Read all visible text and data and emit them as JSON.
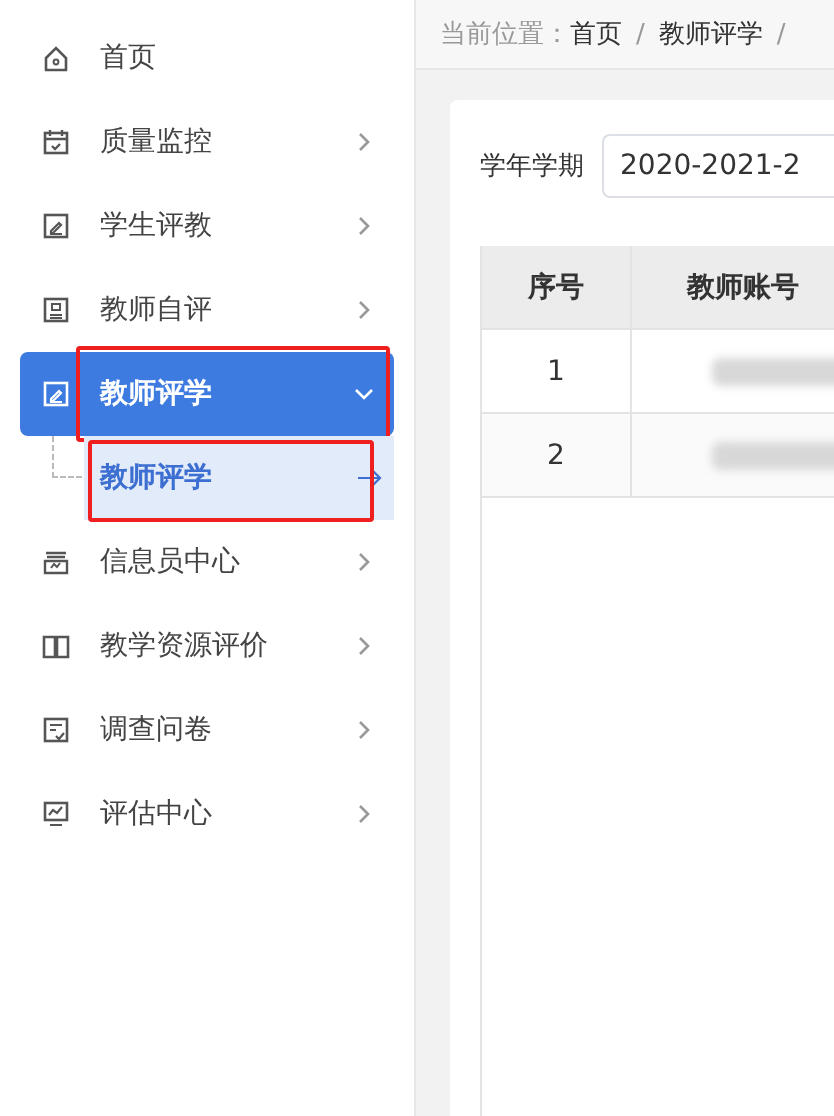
{
  "sidebar": {
    "items": [
      {
        "label": "首页",
        "kind": "link",
        "selected": false,
        "annotated": false
      },
      {
        "label": "质量监控",
        "kind": "submenu",
        "selected": false,
        "expanded": false,
        "annotated": false
      },
      {
        "label": "学生评教",
        "kind": "submenu",
        "selected": false,
        "expanded": false,
        "annotated": false
      },
      {
        "label": "教师自评",
        "kind": "submenu",
        "selected": false,
        "expanded": false,
        "annotated": false
      },
      {
        "label": "教师评学",
        "kind": "submenu",
        "selected": true,
        "expanded": true,
        "annotated": true,
        "children": [
          {
            "label": "教师评学",
            "selected": true,
            "annotated": true
          }
        ]
      },
      {
        "label": "信息员中心",
        "kind": "submenu",
        "selected": false,
        "expanded": false,
        "annotated": false
      },
      {
        "label": "教学资源评价",
        "kind": "submenu",
        "selected": false,
        "expanded": false,
        "annotated": false
      },
      {
        "label": "调查问卷",
        "kind": "submenu",
        "selected": false,
        "expanded": false,
        "annotated": false
      },
      {
        "label": "评估中心",
        "kind": "submenu",
        "selected": false,
        "expanded": false,
        "annotated": false
      }
    ]
  },
  "breadcrumb": {
    "label": "当前位置：",
    "items": [
      {
        "text": "首页",
        "separator": "/"
      },
      {
        "text": "教师评学",
        "separator": "/"
      }
    ]
  },
  "filter": {
    "label": "学年学期",
    "value": "2020-2021-2"
  },
  "table": {
    "columns": [
      "序号",
      "教师账号"
    ],
    "rows": [
      {
        "index": "1",
        "redacted": true
      },
      {
        "index": "2",
        "redacted": true
      }
    ]
  }
}
